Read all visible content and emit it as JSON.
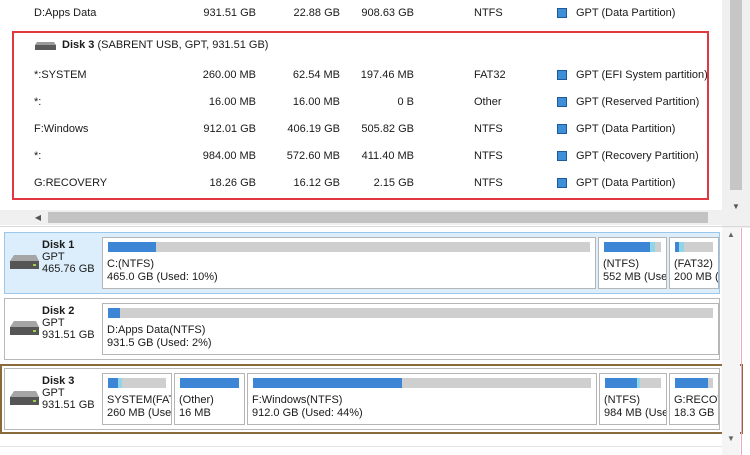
{
  "partition_list": {
    "rows_before": [
      {
        "name": "D:Apps Data",
        "capacity": "931.51 GB",
        "used": "22.88 GB",
        "unused": "908.63 GB",
        "fs": "NTFS",
        "type": "GPT (Data Partition)"
      }
    ],
    "disk3_header": {
      "label": "Disk 3",
      "details": "(SABRENT USB, GPT, 931.51 GB)"
    },
    "disk3_rows": [
      {
        "name": "*:SYSTEM",
        "capacity": "260.00 MB",
        "used": "62.54 MB",
        "unused": "197.46 MB",
        "fs": "FAT32",
        "type": "GPT (EFI System partition)"
      },
      {
        "name": "*:",
        "capacity": "16.00 MB",
        "used": "16.00 MB",
        "unused": "0 B",
        "fs": "Other",
        "type": "GPT (Reserved Partition)"
      },
      {
        "name": "F:Windows",
        "capacity": "912.01 GB",
        "used": "406.19 GB",
        "unused": "505.82 GB",
        "fs": "NTFS",
        "type": "GPT (Data Partition)"
      },
      {
        "name": "*:",
        "capacity": "984.00 MB",
        "used": "572.60 MB",
        "unused": "411.40 MB",
        "fs": "NTFS",
        "type": "GPT (Recovery Partition)"
      },
      {
        "name": "G:RECOVERY",
        "capacity": "18.26 GB",
        "used": "16.12 GB",
        "unused": "2.15 GB",
        "fs": "NTFS",
        "type": "GPT (Data Partition)"
      }
    ]
  },
  "disk_map": {
    "disks": [
      {
        "name": "Disk 1",
        "style": "GPT",
        "size": "465.76 GB",
        "selected": true,
        "partitions": [
          {
            "name": "C:(NTFS)",
            "info": "465.0 GB (Used: 10%)",
            "fill": 0.1,
            "tip": 0
          },
          {
            "name": "(NTFS)",
            "info": "552 MB (Used",
            "fill": 0.8,
            "tip": 0.1
          },
          {
            "name": "(FAT32)",
            "info": "200 MB (Used",
            "fill": 0.1,
            "tip": 0.15
          }
        ]
      },
      {
        "name": "Disk 2",
        "style": "GPT",
        "size": "931.51 GB",
        "selected": false,
        "partitions": [
          {
            "name": "D:Apps Data(NTFS)",
            "info": "931.5 GB (Used: 2%)",
            "fill": 0.02,
            "tip": 0
          }
        ]
      },
      {
        "name": "Disk 3",
        "style": "GPT",
        "size": "931.51 GB",
        "selected": false,
        "partitions": [
          {
            "name": "SYSTEM(FAT3",
            "info": "260 MB (Usec",
            "fill": 0.17,
            "tip": 0.08
          },
          {
            "name": "(Other)",
            "info": "16 MB",
            "fill": 1.0,
            "tip": 0
          },
          {
            "name": "F:Windows(NTFS)",
            "info": "912.0 GB (Used: 44%)",
            "fill": 0.44,
            "tip": 0
          },
          {
            "name": "(NTFS)",
            "info": "984 MB (Usec",
            "fill": 0.58,
            "tip": 0.05
          },
          {
            "name": "G:RECOVERY",
            "info": "18.3 GB (Use",
            "fill": 0.88,
            "tip": 0
          }
        ]
      }
    ]
  },
  "colors": {
    "used_fill": "#3d86d6",
    "unused_track": "#cfcfcf",
    "tip": "#8fd6e8",
    "highlight_red": "#e0383e",
    "highlight_brown": "#8b6a3a"
  },
  "icons": {
    "disk": "hard-drive-icon",
    "partition_type": "blue-square-icon"
  }
}
